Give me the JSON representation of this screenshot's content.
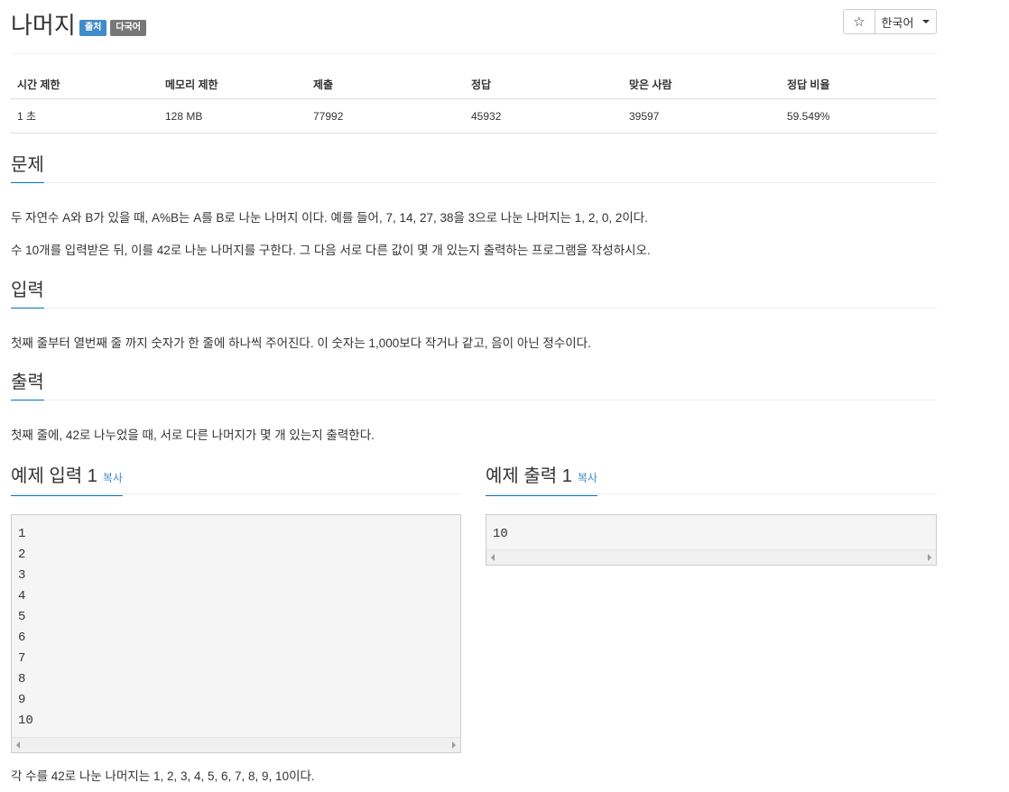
{
  "problem": {
    "title": "나머지",
    "badges": [
      "출처",
      "다국어"
    ],
    "star_icon": "☆",
    "language": "한국어"
  },
  "stats": {
    "headers": [
      "시간 제한",
      "메모리 제한",
      "제출",
      "정답",
      "맞은 사람",
      "정답 비율"
    ],
    "values": [
      "1 초",
      "128 MB",
      "77992",
      "45932",
      "39597",
      "59.549%"
    ]
  },
  "sections": {
    "description": {
      "heading": "문제",
      "paragraphs": [
        "두 자연수 A와 B가 있을 때, A%B는 A를 B로 나눈 나머지 이다. 예를 들어, 7, 14, 27, 38을 3으로 나눈 나머지는 1, 2, 0, 2이다.",
        "수 10개를 입력받은 뒤, 이를 42로 나눈 나머지를 구한다. 그 다음 서로 다른 값이 몇 개 있는지 출력하는 프로그램을 작성하시오."
      ]
    },
    "input": {
      "heading": "입력",
      "text": "첫째 줄부터 열번째 줄 까지 숫자가 한 줄에 하나씩 주어진다. 이 숫자는 1,000보다 작거나 같고, 음이 아닌 정수이다."
    },
    "output": {
      "heading": "출력",
      "text": "첫째 줄에, 42로 나누었을 때, 서로 다른 나머지가 몇 개 있는지 출력한다."
    }
  },
  "samples": {
    "input": {
      "heading": "예제 입력 1",
      "copy_label": "복사",
      "lines": [
        "1",
        "2",
        "3",
        "4",
        "5",
        "6",
        "7",
        "8",
        "9",
        "10"
      ]
    },
    "output": {
      "heading": "예제 출력 1",
      "copy_label": "복사",
      "lines": [
        "10"
      ]
    },
    "note": "각 수를 42로 나눈 나머지는 1, 2, 3, 4, 5, 6, 7, 8, 9, 10이다."
  },
  "colors": {
    "accent": "#0076c0",
    "badge_source": "#428bca",
    "badge_multilang": "#777777"
  }
}
